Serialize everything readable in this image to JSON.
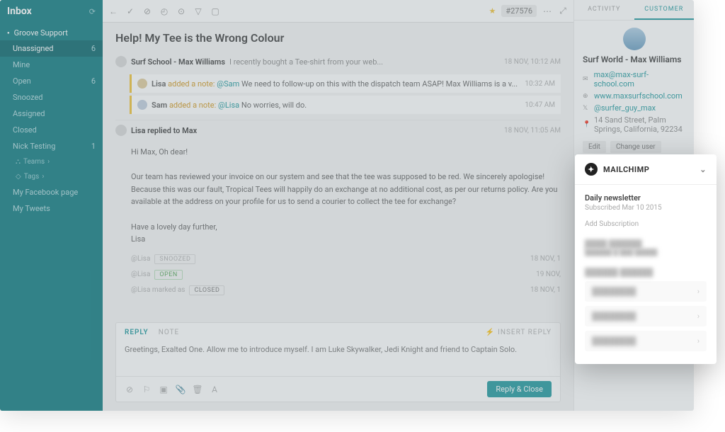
{
  "sidebar": {
    "title": "Inbox",
    "mailbox": "Groove Support",
    "items": [
      {
        "label": "Unassigned",
        "count": "6",
        "active": true
      },
      {
        "label": "Mine",
        "count": ""
      },
      {
        "label": "Open",
        "count": "6"
      },
      {
        "label": "Snoozed",
        "count": ""
      },
      {
        "label": "Assigned",
        "count": ""
      },
      {
        "label": "Closed",
        "count": ""
      },
      {
        "label": "Nick Testing",
        "count": "1"
      }
    ],
    "sub_teams": "Teams",
    "sub_tags": "Tags",
    "extra": [
      {
        "label": "My Facebook page"
      },
      {
        "label": "My Tweets"
      }
    ]
  },
  "toolbar": {
    "ticket": "#27576"
  },
  "ticket": {
    "title": "Help! My Tee is the Wrong Colour",
    "origin_author": "Surf School - Max Williams",
    "origin_preview": "I recently bought a Tee-shirt from your web...",
    "origin_time": "18 NOV, 10:12 AM",
    "note1_author": "Lisa",
    "note1_action": "added a note:",
    "note1_mention": "@Sam",
    "note1_text": "We need to follow-up on this with the dispatch team ASAP! Max Williams is a v...",
    "note1_time": "10:32 AM",
    "note2_author": "Sam",
    "note2_action": "added a note:",
    "note2_mention": "@Lisa",
    "note2_text": "No worries, will do.",
    "note2_time": "10:47 AM",
    "reply_author": "Lisa replied to Max",
    "reply_time": "18 NOV, 11:05 AM",
    "reply_body_1": "Hi Max, Oh dear!",
    "reply_body_2": "Our team has reviewed your invoice on our system and see that the tee was supposed to be red. We sincerely apologise! Because this was our fault, Tropical Tees will happily do an exchange at no additional cost, as per our returns policy. Are you available at the address on your profile for us to send a courier to collect the tee for exchange?",
    "reply_body_3": "Have a lovely day further,",
    "reply_body_4": "Lisa",
    "status1_user": "@Lisa",
    "status1_chip": "SNOOZED",
    "status1_time": "18 NOV, 1",
    "status2_user": "@Lisa",
    "status2_chip": "OPEN",
    "status2_time": "19 NOV,",
    "status3_user": "@Lisa marked as",
    "status3_chip": "CLOSED",
    "status3_time": "18 NOV, 1"
  },
  "compose": {
    "tab_reply": "REPLY",
    "tab_note": "NOTE",
    "insert": "INSERT REPLY",
    "draft": "Greetings, Exalted One. Allow me to introduce myself. I am Luke Skywalker, Jedi Knight and friend to Captain Solo.",
    "send": "Reply & Close"
  },
  "right": {
    "tab_activity": "ACTIVITY",
    "tab_customer": "CUSTOMER",
    "name": "Surf World - Max Williams",
    "email": "max@max-surf-school.com",
    "site": "www.maxsurfschool.com",
    "twitter": "@surfer_guy_max",
    "address": "14 Sand Street, Palm Springs, California, 92234",
    "edit": "Edit",
    "change": "Change user"
  },
  "popover": {
    "title": "MAILCHIMP",
    "list": "Daily newsletter",
    "sub": "Subscribed Mar 10 2015",
    "add": "Add Subscription"
  }
}
